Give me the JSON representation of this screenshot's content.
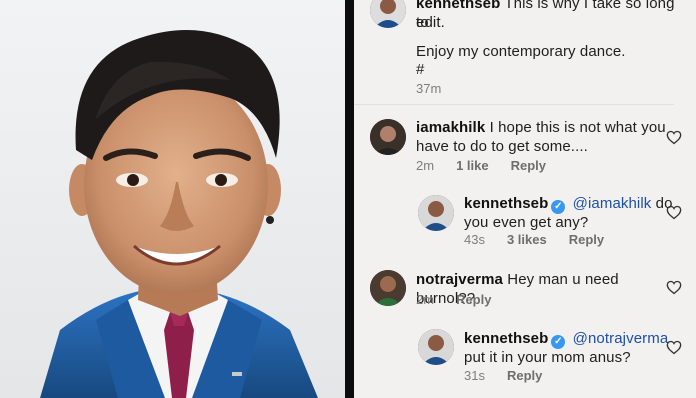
{
  "top_comment": {
    "username": "kennethseb",
    "text_line1": "This is why I take so long to",
    "text_line2": "edit.",
    "text_line3": "Enjoy my contemporary dance.",
    "text_line4": "#",
    "time": "37m"
  },
  "comments": [
    {
      "username": "iamakhilk",
      "text_line1": "I hope this is not what you",
      "text_line2": "have to do to get some....",
      "time": "2m",
      "likes": "1 like",
      "reply_label": "Reply"
    },
    {
      "username": "kennethseb",
      "verified_mark": "✓",
      "mention": "@iamakhilk",
      "text_after_mention": "do",
      "text_line2": "you even get any?",
      "time": "43s",
      "likes": "3 likes",
      "reply_label": "Reply"
    },
    {
      "username": "notrajverma",
      "text_line1": "Hey man u need burnol??",
      "time": "2m",
      "reply_label": "Reply"
    },
    {
      "username": "kennethseb",
      "verified_mark": "✓",
      "mention": "@notrajverma",
      "text_line2": "put it in your mom anus?",
      "time": "31s",
      "reply_label": "Reply"
    }
  ],
  "colors": {
    "mention": "#1e4fa8",
    "verified_badge": "#3897f0",
    "panel_bg": "#f3f1ef",
    "suit": "#1f5fa8"
  },
  "icons": [
    "heart-icon",
    "verified-badge-icon"
  ]
}
